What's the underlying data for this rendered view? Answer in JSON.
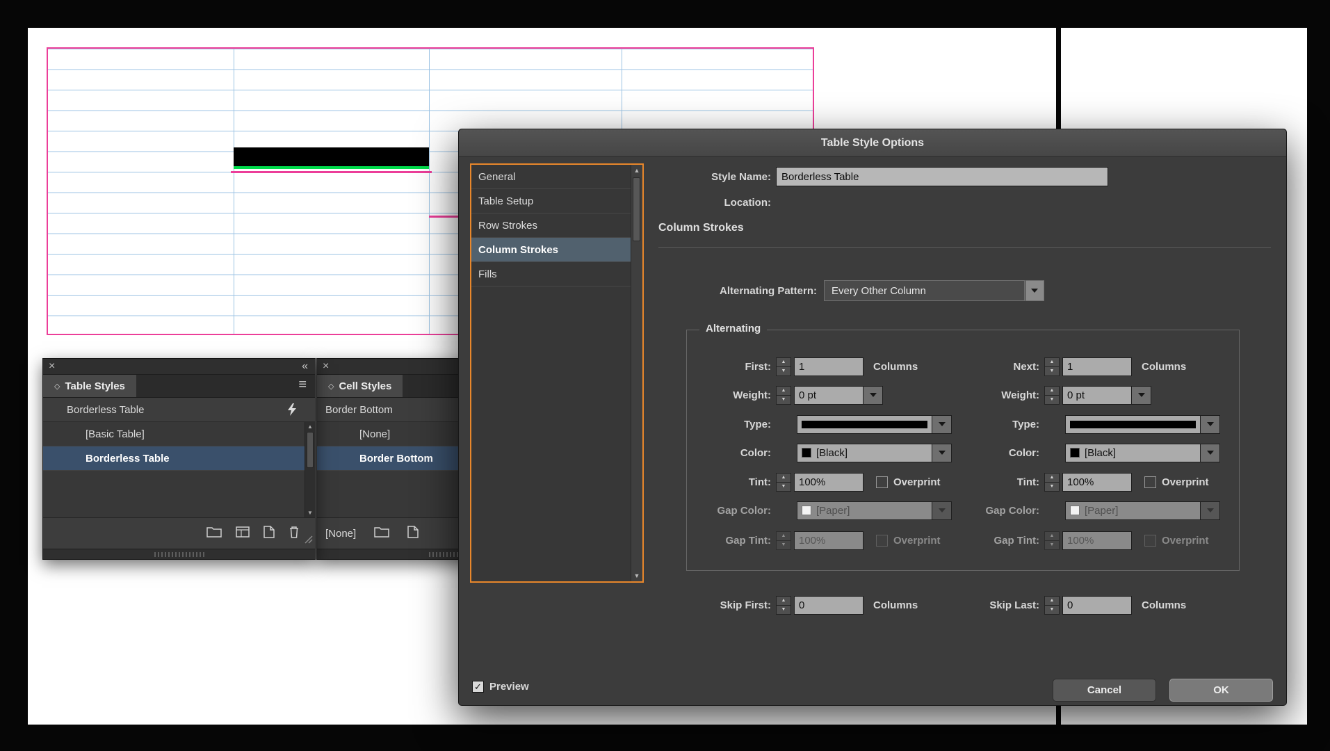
{
  "icons": {
    "close": "×",
    "collapse": "«",
    "menu": "≡",
    "diamond": "◇",
    "check": "✓",
    "up_arrow": "▲",
    "down_arrow": "▼"
  },
  "colors": {
    "accent_orange": "#E8872B",
    "list_selection_blue": "#3A506B",
    "sidebar_selection": "#51616E",
    "document_grid_blue": "#9CC3E4",
    "document_frame_magenta": "#EC3E99",
    "document_stroke_green": "#00DC4B",
    "document_stroke_black": "#000000"
  },
  "dialog": {
    "title": "Table Style Options",
    "sidebar_items": [
      {
        "label": "General"
      },
      {
        "label": "Table Setup"
      },
      {
        "label": "Row Strokes"
      },
      {
        "label": "Column Strokes",
        "selected": true
      },
      {
        "label": "Fills"
      }
    ],
    "style_name_label": "Style Name:",
    "style_name_value": "Borderless Table",
    "location_label": "Location:",
    "section_heading": "Column Strokes",
    "alternating_pattern_label": "Alternating Pattern:",
    "alternating_pattern_value": "Every Other Column",
    "group_legend": "Alternating",
    "left": {
      "first_label": "First:",
      "first_value": "1",
      "first_suffix": "Columns",
      "weight_label": "Weight:",
      "weight_value": "0 pt",
      "type_label": "Type:",
      "color_label": "Color:",
      "color_value": "[Black]",
      "tint_label": "Tint:",
      "tint_value": "100%",
      "overprint_label": "Overprint",
      "gap_color_label": "Gap Color:",
      "gap_color_value": "[Paper]",
      "gap_tint_label": "Gap Tint:",
      "gap_tint_value": "100%",
      "gap_overprint_label": "Overprint"
    },
    "right": {
      "next_label": "Next:",
      "next_value": "1",
      "next_suffix": "Columns",
      "weight_label": "Weight:",
      "weight_value": "0 pt",
      "type_label": "Type:",
      "color_label": "Color:",
      "color_value": "[Black]",
      "tint_label": "Tint:",
      "tint_value": "100%",
      "overprint_label": "Overprint",
      "gap_color_label": "Gap Color:",
      "gap_color_value": "[Paper]",
      "gap_tint_label": "Gap Tint:",
      "gap_tint_value": "100%",
      "gap_overprint_label": "Overprint"
    },
    "skip_first_label": "Skip First:",
    "skip_first_value": "0",
    "skip_first_suffix": "Columns",
    "skip_last_label": "Skip Last:",
    "skip_last_value": "0",
    "skip_last_suffix": "Columns",
    "preview_label": "Preview",
    "cancel_label": "Cancel",
    "ok_label": "OK"
  },
  "table_styles_panel": {
    "tab": "Table Styles",
    "current_style": "Borderless Table",
    "items": [
      {
        "label": "[Basic Table]"
      },
      {
        "label": "Borderless Table",
        "selected": true
      }
    ]
  },
  "cell_styles_panel": {
    "tab": "Cell Styles",
    "current_style": "Border Bottom",
    "items": [
      {
        "label": "[None]"
      },
      {
        "label": "Border Bottom",
        "selected": true
      }
    ],
    "bottom_label": "[None]"
  }
}
